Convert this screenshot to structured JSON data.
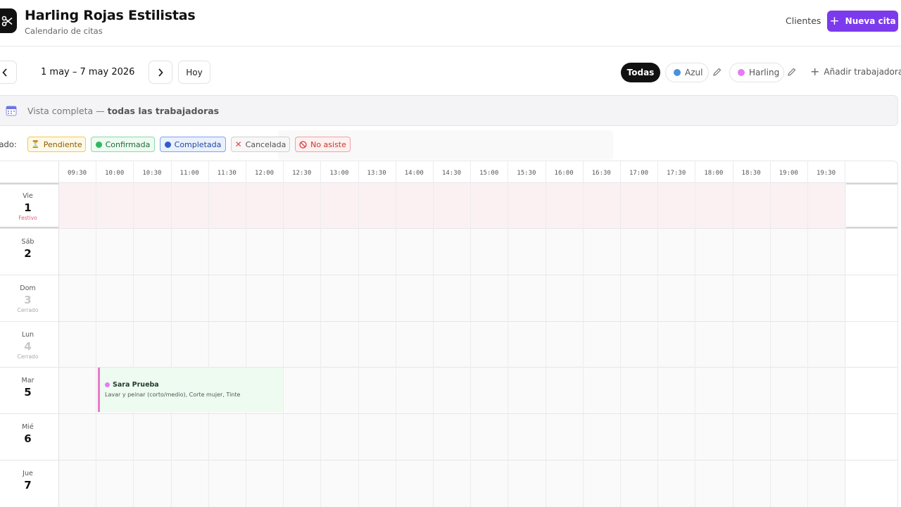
{
  "header": {
    "title": "Harling Rojas Estilistas",
    "subtitle": "Calendario de citas",
    "clients_label": "Clientes",
    "new_appointment_label": "Nueva cita"
  },
  "toolbar": {
    "date_range": "1 may – 7 may 2026",
    "today_label": "Hoy",
    "filters": {
      "all_label": "Todas",
      "workers": [
        {
          "name": "Azul",
          "color": "#4a90e2"
        },
        {
          "name": "Harling",
          "color": "#e879f9"
        }
      ],
      "add_worker_label": "Añadir trabajadora"
    }
  },
  "banner": {
    "text_prefix": "Vista completa — ",
    "text_bold": "todas las trabajadoras"
  },
  "legend": {
    "label": "tado:",
    "statuses": [
      {
        "label": "Pendiente",
        "icon": "hourglass-icon"
      },
      {
        "label": "Confirmada",
        "icon": "green-circle-icon"
      },
      {
        "label": "Completada",
        "icon": "blue-circle-icon"
      },
      {
        "label": "Cancelada",
        "icon": "x-icon"
      },
      {
        "label": "No asiste",
        "icon": "no-entry-icon"
      }
    ]
  },
  "calendar": {
    "times": [
      "09:30",
      "10:00",
      "10:30",
      "11:00",
      "11:30",
      "12:00",
      "12:30",
      "13:00",
      "13:30",
      "14:00",
      "14:30",
      "15:00",
      "15:30",
      "16:00",
      "16:30",
      "17:00",
      "17:30",
      "18:00",
      "18:30",
      "19:00",
      "19:30"
    ],
    "days": [
      {
        "abbr": "Vie",
        "num": "1",
        "note": "Festivo",
        "state": "holiday"
      },
      {
        "abbr": "Sáb",
        "num": "2",
        "note": "",
        "state": "open"
      },
      {
        "abbr": "Dom",
        "num": "3",
        "note": "Cerrado",
        "state": "closed"
      },
      {
        "abbr": "Lun",
        "num": "4",
        "note": "Cerrado",
        "state": "closed"
      },
      {
        "abbr": "Mar",
        "num": "5",
        "note": "",
        "state": "open"
      },
      {
        "abbr": "Mié",
        "num": "6",
        "note": "",
        "state": "open"
      },
      {
        "abbr": "Jue",
        "num": "7",
        "note": "",
        "state": "open"
      }
    ],
    "appointments": [
      {
        "client": "Sara Prueba",
        "services": "Lavar y peinar (corto/medio), Corte mujer, Tinte",
        "day": "5",
        "start": "10:00",
        "status": "Confirmada",
        "worker_color": "#e879f9"
      }
    ]
  }
}
